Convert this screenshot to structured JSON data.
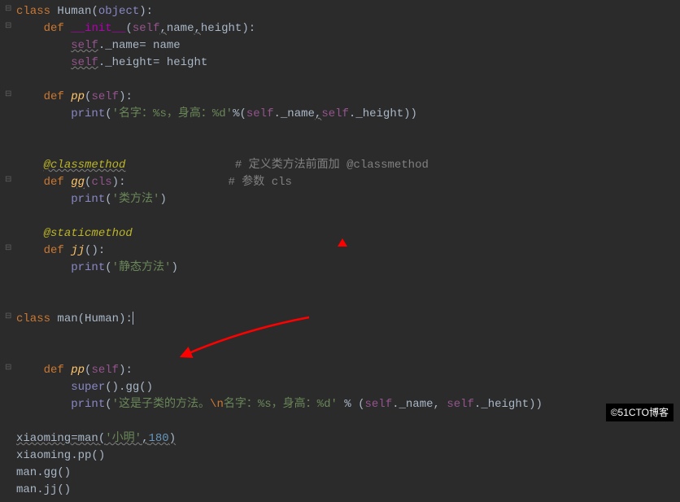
{
  "code": {
    "l1": {
      "class": "class",
      "name": "Human",
      "obj": "object"
    },
    "l2": {
      "def": "def",
      "init": "__init__",
      "self": "self",
      "p1": "name",
      "p2": "height"
    },
    "l3": {
      "self": "self",
      "attr": "._name= ",
      "val": "name"
    },
    "l4": {
      "self": "self",
      "attr": "._height= ",
      "val": "height"
    },
    "l5": {
      "def": "def",
      "name": "pp",
      "self": "self"
    },
    "l6": {
      "print": "print",
      "str1": "'名字：%s，身高：%d'",
      "pct": "%(",
      "self1": "self",
      "a1": "._name",
      "c": ",",
      "self2": "self",
      "a2": "._height))"
    },
    "l7": {
      "dec": "@classmethod",
      "comment": "# 定义类方法前面加 @classmethod"
    },
    "l8": {
      "def": "def",
      "name": "gg",
      "cls": "cls",
      "comment": "# 参数 cls"
    },
    "l9": {
      "print": "print",
      "str": "'类方法'"
    },
    "l10": {
      "dec": "@staticmethod"
    },
    "l11": {
      "def": "def",
      "name": "jj"
    },
    "l12": {
      "print": "print",
      "str": "'静态方法'"
    },
    "l13": {
      "class": "class",
      "name": "man",
      "base": "Human"
    },
    "l14": {
      "def": "def",
      "name": "pp",
      "self": "self"
    },
    "l15": {
      "super": "super",
      "gg": "gg"
    },
    "l16": {
      "print": "print",
      "str1": "'这是子类的方法。",
      "esc": "\\n",
      "str2": "名字：%s，身高：%d'",
      "pct": " % (",
      "self1": "self",
      "a1": "._name, ",
      "self2": "self",
      "a2": "._height))"
    },
    "l17": {
      "var": "xiaoming",
      "eq": "=",
      "cls": "man",
      "arg1": "'小明'",
      "c": ",",
      "arg2": "180"
    },
    "l18": {
      "txt": "xiaoming.pp()"
    },
    "l19": {
      "txt": "man.gg()"
    },
    "l20": {
      "txt": "man.jj()"
    }
  },
  "watermark": "©51CTO博客"
}
